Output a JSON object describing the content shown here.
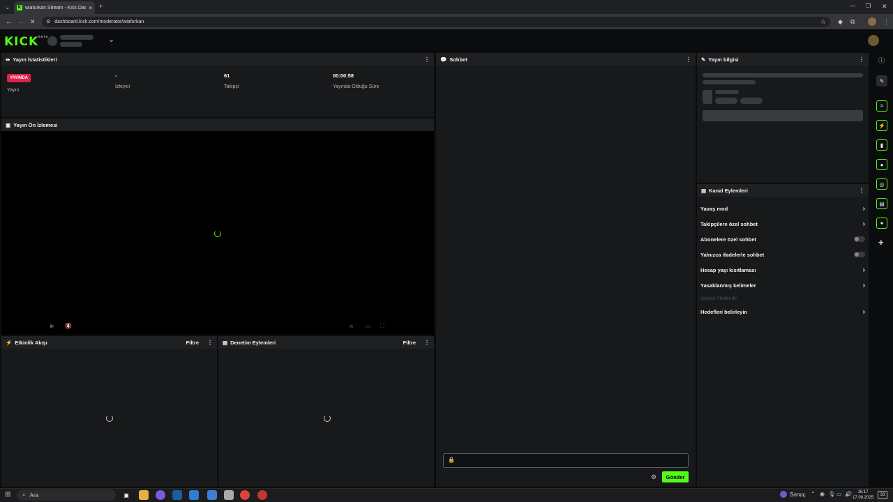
{
  "browser": {
    "tab_title": "wiafurkan Stream - Kick Dashb...",
    "url": "dashboard.kick.com/moderator/wiafurkan",
    "new_tab": "+",
    "close_tab": "×"
  },
  "app": {
    "logo": "KICK",
    "logo_tag": "beta"
  },
  "stats": {
    "title": "Yayın İstatistikleri",
    "live_badge": "YAYINDA",
    "live_label": "Yayın",
    "viewers_value": "-",
    "viewers_label": "İzleyici",
    "followers_value": "61",
    "followers_label": "Takipçi",
    "uptime_value": "00:00:58",
    "uptime_label": "Yayında Olduğu Süre"
  },
  "preview": {
    "title": "Yayın Ön İzlemesi"
  },
  "activity": {
    "title": "Etkinlik Akışı",
    "filter": "Filtre"
  },
  "moderation": {
    "title": "Denetim Eylemleri",
    "filter": "Filtre"
  },
  "chat": {
    "title": "Sohbet",
    "send": "Gönder"
  },
  "stream_info": {
    "title": "Yayın bilgisi"
  },
  "channel_actions": {
    "title": "Kanal Eylemleri",
    "items": [
      {
        "label": "Yavaş mod",
        "kind": "chevron"
      },
      {
        "label": "Takipçilere özel sohbet",
        "kind": "chevron"
      },
      {
        "label": "Abonelere özel sohbet",
        "kind": "toggle"
      },
      {
        "label": "Yalnızca ifadelerle sohbet",
        "kind": "toggle"
      },
      {
        "label": "Hesap yaşı kısıtlaması",
        "kind": "chevron"
      },
      {
        "label": "Yasaklanmış kelimeler",
        "kind": "chevron"
      },
      {
        "label": "İzleyici Yönlendir",
        "kind": "disabled"
      },
      {
        "label": "Hedefleri belirleyin",
        "kind": "chevron"
      }
    ]
  },
  "taskbar": {
    "search": "Ara",
    "weather": "Sonuç",
    "time": "16:17",
    "date": "17.08.2025",
    "notif": "33"
  },
  "colors": {
    "accent": "#53fc18",
    "live": "#e0224b",
    "panel": "#18191b"
  }
}
